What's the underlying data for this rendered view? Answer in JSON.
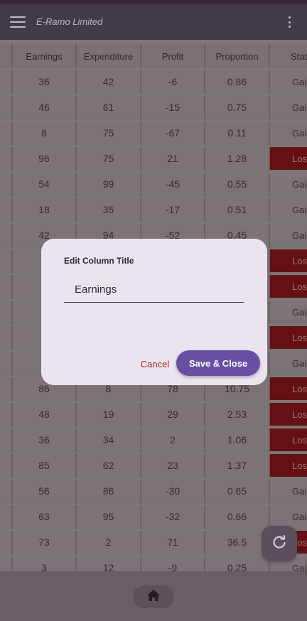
{
  "app": {
    "title": "E-Ramo Limited"
  },
  "table": {
    "headers": [
      "",
      "Earnings",
      "Expenditure",
      "Profit",
      "Proportion",
      "Stat"
    ],
    "rows": [
      {
        "earnings": "36",
        "expenditure": "42",
        "profit": "-6",
        "proportion": "0.86",
        "status": "Gai",
        "loss": false
      },
      {
        "earnings": "46",
        "expenditure": "61",
        "profit": "-15",
        "proportion": "0.75",
        "status": "Gai",
        "loss": false
      },
      {
        "earnings": "8",
        "expenditure": "75",
        "profit": "-67",
        "proportion": "0.11",
        "status": "Gai",
        "loss": false
      },
      {
        "earnings": "96",
        "expenditure": "75",
        "profit": "21",
        "proportion": "1.28",
        "status": "Los",
        "loss": true
      },
      {
        "earnings": "54",
        "expenditure": "99",
        "profit": "-45",
        "proportion": "0.55",
        "status": "Gai",
        "loss": false
      },
      {
        "earnings": "18",
        "expenditure": "35",
        "profit": "-17",
        "proportion": "0.51",
        "status": "Gai",
        "loss": false
      },
      {
        "earnings": "42",
        "expenditure": "94",
        "profit": "-52",
        "proportion": "0.45",
        "status": "Gai",
        "loss": false
      },
      {
        "earnings": "",
        "expenditure": "",
        "profit": "",
        "proportion": "",
        "status": "Los",
        "loss": true
      },
      {
        "earnings": "",
        "expenditure": "",
        "profit": "",
        "proportion": "",
        "status": "Los",
        "loss": true
      },
      {
        "earnings": "",
        "expenditure": "",
        "profit": "",
        "proportion": "",
        "status": "Gai",
        "loss": false
      },
      {
        "earnings": "",
        "expenditure": "",
        "profit": "",
        "proportion": "",
        "status": "Los",
        "loss": true
      },
      {
        "earnings": "",
        "expenditure": "",
        "profit": "",
        "proportion": "",
        "status": "Gai",
        "loss": false
      },
      {
        "earnings": "86",
        "expenditure": "8",
        "profit": "78",
        "proportion": "10.75",
        "status": "Los",
        "loss": true
      },
      {
        "earnings": "48",
        "expenditure": "19",
        "profit": "29",
        "proportion": "2.53",
        "status": "Los",
        "loss": true
      },
      {
        "earnings": "36",
        "expenditure": "34",
        "profit": "2",
        "proportion": "1.06",
        "status": "Los",
        "loss": true
      },
      {
        "earnings": "85",
        "expenditure": "62",
        "profit": "23",
        "proportion": "1.37",
        "status": "Los",
        "loss": true
      },
      {
        "earnings": "56",
        "expenditure": "86",
        "profit": "-30",
        "proportion": "0.65",
        "status": "Gai",
        "loss": false
      },
      {
        "earnings": "63",
        "expenditure": "95",
        "profit": "-32",
        "proportion": "0.66",
        "status": "Gai",
        "loss": false
      },
      {
        "earnings": "73",
        "expenditure": "2",
        "profit": "71",
        "proportion": "36.5",
        "status": "Los",
        "loss": true
      },
      {
        "earnings": "3",
        "expenditure": "12",
        "profit": "-9",
        "proportion": "0.25",
        "status": "Gai",
        "loss": false
      }
    ]
  },
  "dialog": {
    "title": "Edit Column Title",
    "input_value": "Earnings",
    "cancel_label": "Cancel",
    "save_label": "Save & Close"
  },
  "icons": {
    "menu": "menu-icon",
    "more": "more-vertical-icon",
    "refresh": "refresh-icon",
    "home": "home-icon"
  },
  "colors": {
    "app_bar": "#3b3a4a",
    "loss_cell": "#6a0000",
    "primary": "#6750a4",
    "cancel_text": "#b3261e"
  }
}
